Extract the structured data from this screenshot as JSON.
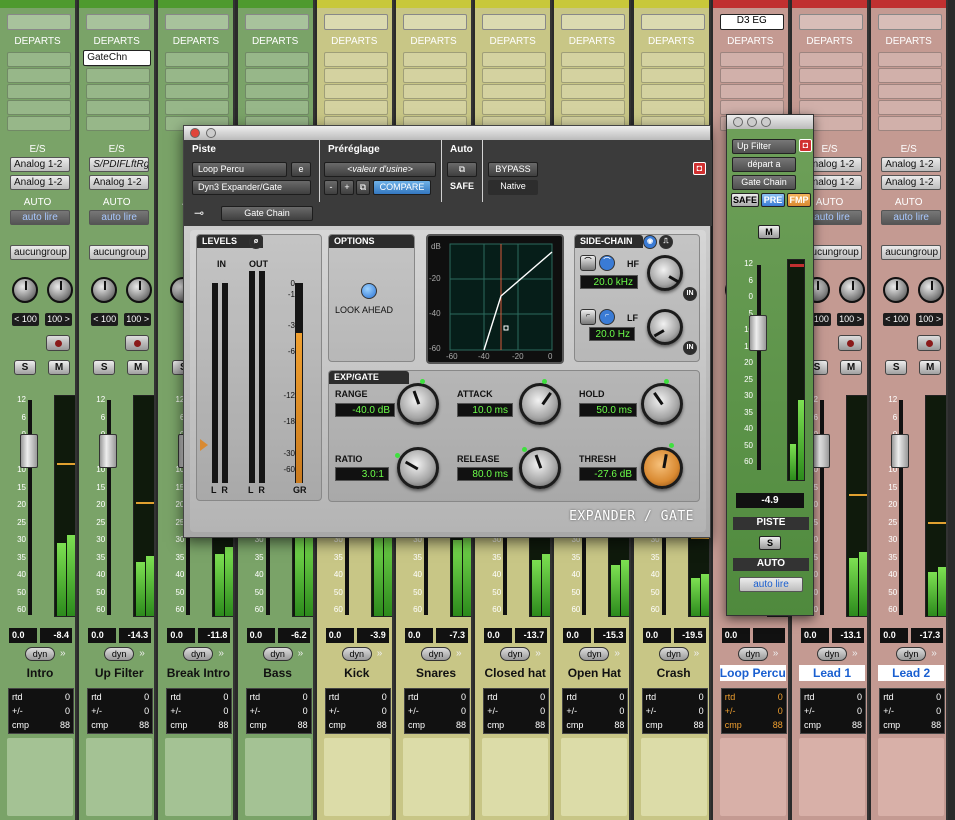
{
  "strips": [
    {
      "name": "Intro",
      "color": "#4e9a2e",
      "face": "#7aa368",
      "footer": "#a4c294",
      "insert": "",
      "send": "",
      "io_in": "Analog 1-2",
      "io_out": "Analog 1-2",
      "auto": "auto lire",
      "group": "aucungroup",
      "pan_l": "< 100",
      "pan_r": "100 >",
      "vol": "0.0",
      "peak": "-8.4",
      "name_highlight": false,
      "rtd": "0",
      "plusminus": "0",
      "cmp": "88",
      "cmp_orange": false
    },
    {
      "name": "Up Filter",
      "color": "#4e9a2e",
      "face": "#7aa368",
      "footer": "#a4c294",
      "insert": "GateChn",
      "send": "",
      "io_in": "S/PDIFLftRg",
      "io_out": "Analog 1-2",
      "auto": "auto lire",
      "group": "aucungroup",
      "pan_l": "< 100",
      "pan_r": "100 >",
      "vol": "0.0",
      "peak": "-14.3",
      "name_highlight": false,
      "rtd": "0",
      "plusminus": "0",
      "cmp": "88",
      "cmp_orange": false
    },
    {
      "name": "Break Intro",
      "color": "#4e9a2e",
      "face": "#7aa368",
      "footer": "#a4c294",
      "insert": "",
      "send": "",
      "io_in": "",
      "io_out": "",
      "auto": "",
      "group": "",
      "pan_l": "",
      "pan_r": "",
      "vol": "0.0",
      "peak": "-11.8",
      "name_highlight": false,
      "rtd": "0",
      "plusminus": "0",
      "cmp": "88",
      "cmp_orange": false
    },
    {
      "name": "Bass",
      "color": "#4e9a2e",
      "face": "#7aa368",
      "footer": "#a4c294",
      "insert": "",
      "send": "",
      "io_in": "",
      "io_out": "",
      "auto": "",
      "group": "",
      "pan_l": "",
      "pan_r": "",
      "vol": "0.0",
      "peak": "-6.2",
      "name_highlight": false,
      "rtd": "0",
      "plusminus": "0",
      "cmp": "88",
      "cmp_orange": false
    },
    {
      "name": "Kick",
      "color": "#c8c83a",
      "face": "#c8c686",
      "footer": "#dcdca8",
      "insert": "",
      "send": "",
      "io_in": "",
      "io_out": "",
      "auto": "",
      "group": "",
      "pan_l": "",
      "pan_r": "",
      "vol": "0.0",
      "peak": "-3.9",
      "name_highlight": false,
      "rtd": "0",
      "plusminus": "0",
      "cmp": "88",
      "cmp_orange": false
    },
    {
      "name": "Snares",
      "color": "#c8c83a",
      "face": "#c8c686",
      "footer": "#dcdca8",
      "insert": "",
      "send": "",
      "io_in": "",
      "io_out": "",
      "auto": "",
      "group": "",
      "pan_l": "",
      "pan_r": "",
      "vol": "0.0",
      "peak": "-7.3",
      "name_highlight": false,
      "rtd": "0",
      "plusminus": "0",
      "cmp": "88",
      "cmp_orange": false
    },
    {
      "name": "Closed hat",
      "color": "#c8c83a",
      "face": "#c8c686",
      "footer": "#dcdca8",
      "insert": "",
      "send": "",
      "io_in": "",
      "io_out": "",
      "auto": "",
      "group": "",
      "pan_l": "",
      "pan_r": "",
      "vol": "0.0",
      "peak": "-13.7",
      "name_highlight": false,
      "rtd": "0",
      "plusminus": "0",
      "cmp": "88",
      "cmp_orange": false
    },
    {
      "name": "Open Hat",
      "color": "#c8c83a",
      "face": "#c8c686",
      "footer": "#dcdca8",
      "insert": "",
      "send": "",
      "io_in": "",
      "io_out": "",
      "auto": "",
      "group": "",
      "pan_l": "",
      "pan_r": "",
      "vol": "0.0",
      "peak": "-15.3",
      "name_highlight": false,
      "rtd": "0",
      "plusminus": "0",
      "cmp": "88",
      "cmp_orange": false
    },
    {
      "name": "Crash",
      "color": "#c8c83a",
      "face": "#c8c686",
      "footer": "#dcdca8",
      "insert": "",
      "send": "",
      "io_in": "",
      "io_out": "",
      "auto": "",
      "group": "",
      "pan_l": "",
      "pan_r": "",
      "vol": "0.0",
      "peak": "-19.5",
      "name_highlight": false,
      "rtd": "0",
      "plusminus": "0",
      "cmp": "88",
      "cmp_orange": false
    },
    {
      "name": "Loop Percu",
      "color": "#c03030",
      "face": "#c49a92",
      "footer": "#d8b0a8",
      "insert": "D3 EG",
      "send": "",
      "io_in": "",
      "io_out": "",
      "auto": "",
      "group": "",
      "pan_l": "",
      "pan_r": "",
      "vol": "0.0",
      "peak": "",
      "name_highlight": true,
      "rtd": "0",
      "plusminus": "0",
      "cmp": "88",
      "cmp_orange": true
    },
    {
      "name": "Lead 1",
      "color": "#c03030",
      "face": "#c49a92",
      "footer": "#d8b0a8",
      "insert": "",
      "send": "",
      "io_in": "Analog 1-2",
      "io_out": "Analog 1-2",
      "auto": "auto lire",
      "group": "aucungroup",
      "pan_l": "< 100",
      "pan_r": "100 >",
      "vol": "0.0",
      "peak": "-13.1",
      "name_highlight": true,
      "rtd": "0",
      "plusminus": "0",
      "cmp": "88",
      "cmp_orange": false
    },
    {
      "name": "Lead 2",
      "color": "#c03030",
      "face": "#c49a92",
      "footer": "#d8b0a8",
      "insert": "",
      "send": "",
      "io_in": "Analog 1-2",
      "io_out": "Analog 1-2",
      "auto": "auto lire",
      "group": "aucungroup",
      "pan_l": "< 100",
      "pan_r": "100 >",
      "vol": "0.0",
      "peak": "-17.3",
      "name_highlight": true,
      "rtd": "0",
      "plusminus": "0",
      "cmp": "88",
      "cmp_orange": false
    }
  ],
  "labels": {
    "departs": "DEPARTS",
    "es": "E/S",
    "auto": "AUTO",
    "solo": "S",
    "mute": "M",
    "dyn": "dyn",
    "rtd": "rtd",
    "plusminus": "+/-",
    "cmp": "cmp"
  },
  "fader_scale": [
    "12",
    "6",
    "0",
    "5",
    "10",
    "15",
    "20",
    "25",
    "30",
    "35",
    "40",
    "50",
    "60"
  ],
  "plugin": {
    "piste_label": "Piste",
    "preset_label": "Préréglage",
    "auto_label": "Auto",
    "track": "Loop Percu",
    "track_btn": "e",
    "insert": "Dyn3 Expander/Gate",
    "preset": "<valeur d'usine>",
    "minus": "-",
    "plus": "+",
    "compare": "COMPARE",
    "safe": "SAFE",
    "bypass": "BYPASS",
    "native": "Native",
    "key_input": "Gate Chain",
    "levels_title": "LEVELS",
    "in_label": "IN",
    "out_label": "OUT",
    "scale": [
      "0",
      "-1",
      "-3",
      "-6",
      "-12",
      "-18",
      "-30",
      "-60"
    ],
    "lr_in": "L  R",
    "lr_out": "L  R",
    "gr_label": "GR",
    "options_title": "OPTIONS",
    "look_ahead": "LOOK AHEAD",
    "graph_db": "dB",
    "graph_y": [
      "-20",
      "-40",
      "-60"
    ],
    "graph_x": [
      "-60",
      "-40",
      "-20",
      "0"
    ],
    "sidechain_title": "SIDE-CHAIN",
    "hf_label": "HF",
    "hf_value": "20.0 kHz",
    "lf_label": "LF",
    "lf_value": "20.0 Hz",
    "in_btn": "IN",
    "expgate_title": "EXP/GATE",
    "range_label": "RANGE",
    "range_value": "-40.0 dB",
    "attack_label": "ATTACK",
    "attack_value": "10.0 ms",
    "hold_label": "HOLD",
    "hold_value": "50.0 ms",
    "ratio_label": "RATIO",
    "ratio_value": "3.0:1",
    "release_label": "RELEASE",
    "release_value": "80.0 ms",
    "thresh_label": "THRESH",
    "thresh_value": "-27.6 dB",
    "brand": "EXPANDER / GATE",
    "accent": "#3a7bd5",
    "lcd_color": "#6cff4a",
    "gr_color": "#f0a030",
    "thresh_knob": "#d98a32"
  },
  "sidewin": {
    "insert": "Up Filter",
    "send": "départ a",
    "gate": "Gate Chain",
    "safe": "SAFE",
    "pre": "PRE",
    "fmp": "FMP",
    "mute": "M",
    "scale": [
      "12",
      "6",
      "0",
      "5",
      "10",
      "15",
      "20",
      "25",
      "30",
      "35",
      "40",
      "50",
      "60"
    ],
    "vol": "-4.9",
    "piste": "PISTE",
    "solo": "S",
    "auto": "AUTO",
    "auto_mode": "auto lire"
  }
}
